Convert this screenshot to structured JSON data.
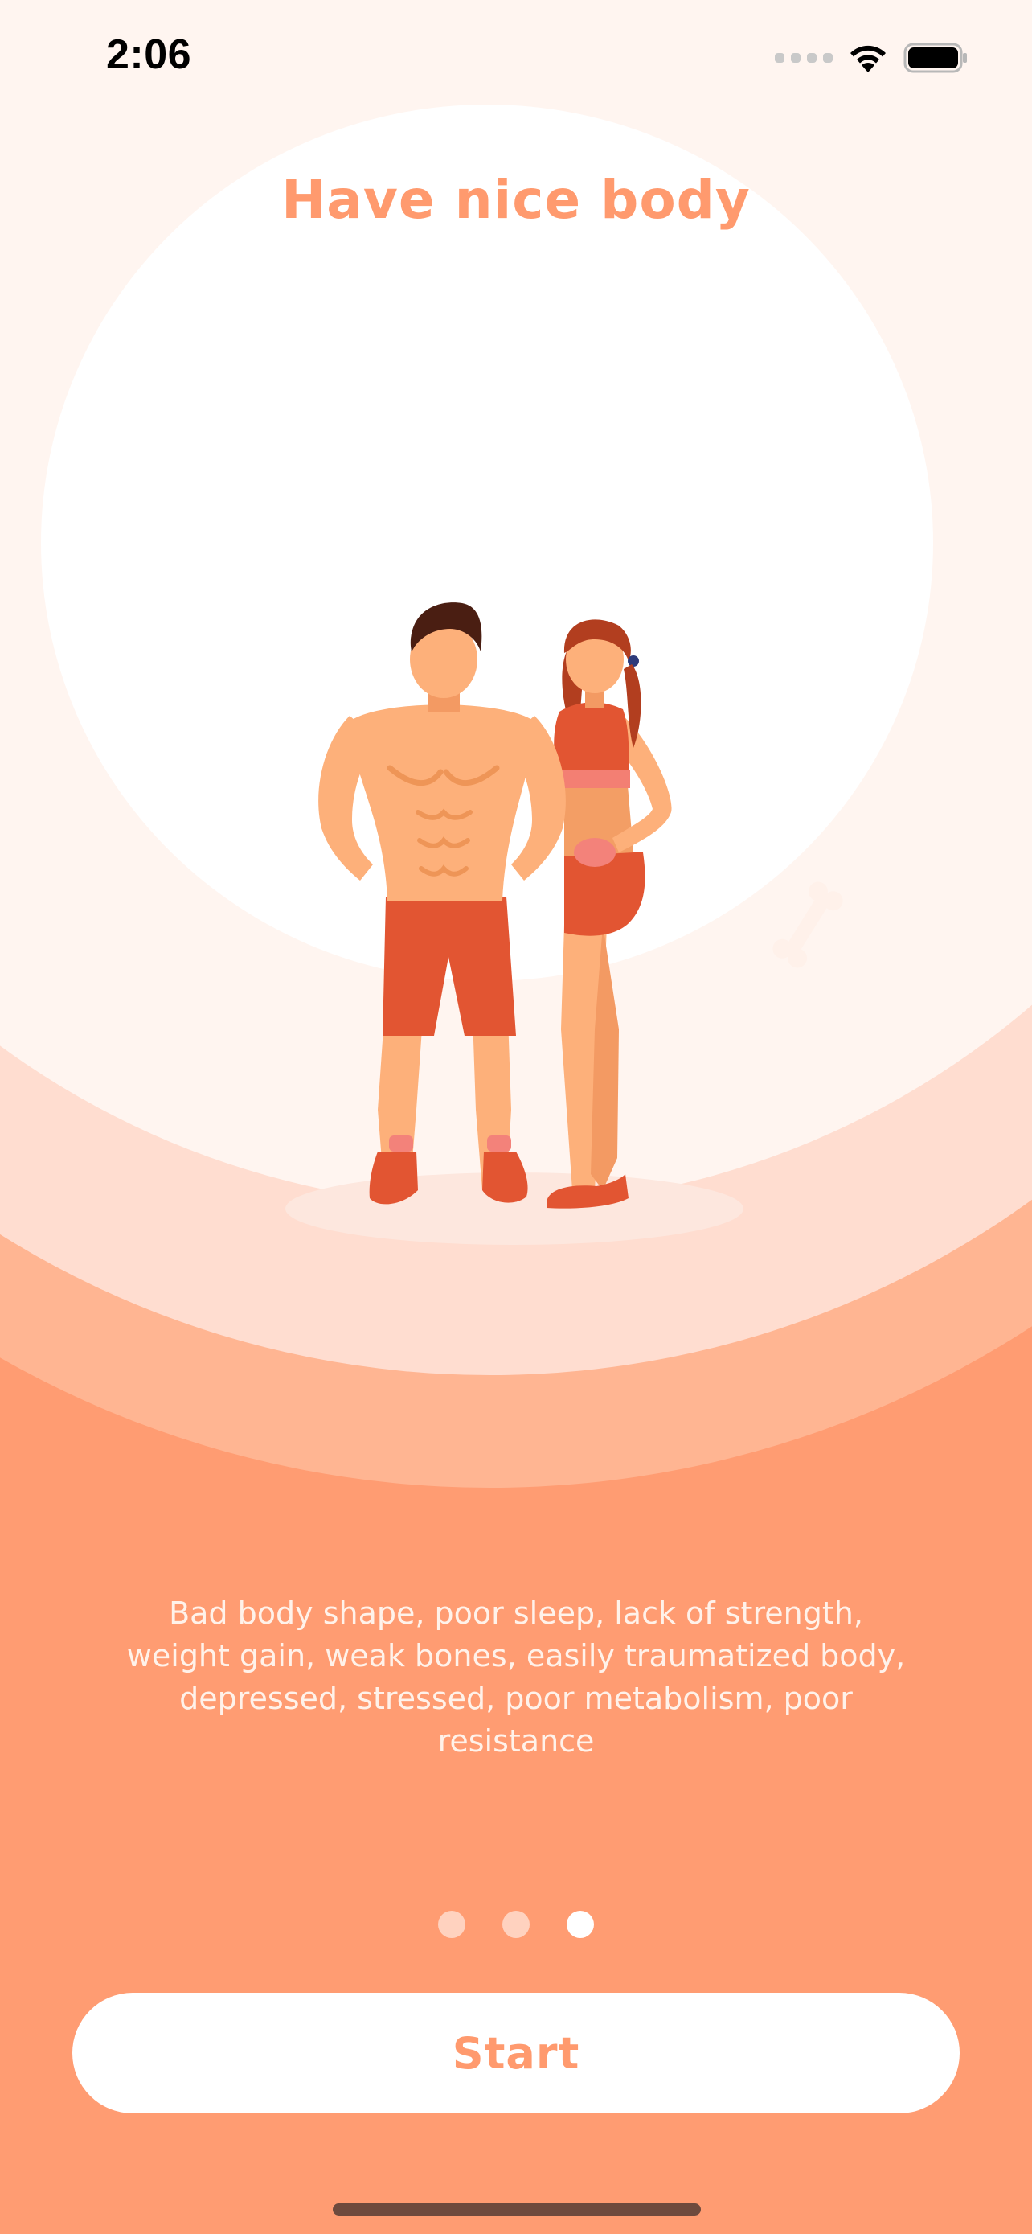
{
  "status_bar": {
    "time": "2:06"
  },
  "onboarding": {
    "title": "Have nice body",
    "description": "Bad body shape, poor sleep, lack of strength, weight gain, weak bones, easily traumatized body, depressed, stressed, poor metabolism, poor resistance",
    "page_indicator": {
      "total": 3,
      "current": 3
    },
    "start_label": "Start"
  },
  "colors": {
    "accent": "#FF9C72",
    "title": "#FF9A6E",
    "button_background": "#FFFFFF"
  },
  "icons": {
    "status": [
      "cellular-signal-icon",
      "wifi-icon",
      "battery-icon"
    ],
    "illustration": "fit-couple-illustration"
  }
}
